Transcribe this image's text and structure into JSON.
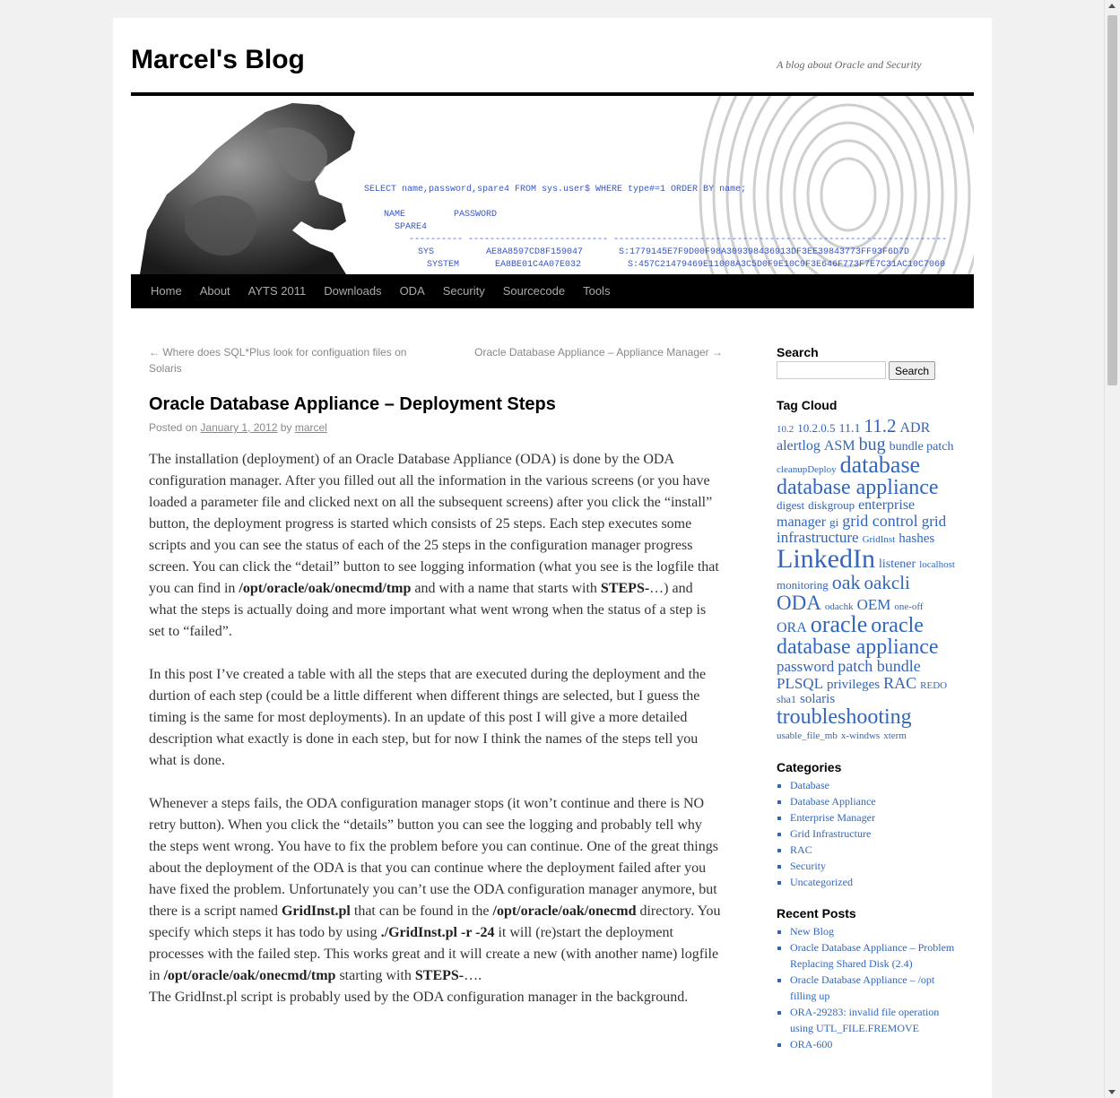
{
  "site": {
    "title": "Marcel's Blog",
    "description": "A blog about Oracle and Security"
  },
  "banner": {
    "sql_line": "SELECT name,password,spare4 FROM sys.user$ WHERE type#=1 ORDER BY name;",
    "col1": "NAME",
    "col2": "PASSWORD",
    "col3": "SPARE4",
    "dashes": "---------- -------------------------- --------------------------------------------------------------",
    "row1_name": "SYS",
    "row1_hash": "AE8A8597CD8F159047",
    "row1_spare": "S:1779145E7F9D00F98A309398436913DF3EE39843773FF93F6D7D",
    "row2_name": "SYSTEM",
    "row2_hash": "EA8BE01C4A07E032",
    "row2_spare": "S:457C21479469E11008A3C5D0F9E10C9F3E646F773F7E7C31AC10C7060"
  },
  "menu": [
    "Home",
    "About",
    "AYTS 2011",
    "Downloads",
    "ODA",
    "Security",
    "Sourcecode",
    "Tools"
  ],
  "post": {
    "nav_prev": "← Where does SQL*Plus look for configuation files on Solaris",
    "nav_next": "Oracle Database Appliance – Appliance Manager →",
    "title": "Oracle Database Appliance – Deployment Steps",
    "posted_on": "Posted on",
    "date": "January 1, 2012",
    "by": "by",
    "author": "marcel",
    "p1a": "The installation (deployment) of an Oracle Database Appliance (ODA) is done by the ODA configuration manager. After you filled out all the information in the various screens (or you have loaded a parameter file and clicked next on all the subsequent screens) after you click the “install” button, the deployment progress is started which consists of 25 steps. Each step executes some scripts and you can see the status of each of the 25 steps in the configuration manager progress screen. You can click the “detail” button to see logging information (what you see is the logfile that you can find in ",
    "p1b": "/opt/oracle/oak/onecmd/tmp",
    "p1c": " and with a name that starts with ",
    "p1d": "STEPS-",
    "p1e": "…) and what the steps is actually doing and more important what went wrong when the status of a step is set to “failed”.",
    "p2": "In this post I’ve created a table with all the steps that are executed during the deployment and the durtion of each step (could be a little different when different things are selected, but I guess the timing is the same for most deployments). In an update of this post I will give a more detailed description what exactly is done in each step, but for now I think the names of the steps tell you what is done.",
    "p3a": "Whenever a steps fails, the ODA configuration manager stops (it won’t continue and there is NO retry button). When you click the “details” button you can see the logging and probably tell why the steps went wrong. You have to fix the problem before you can continue. One of the great things about the deployment of the ODA is that you can continue where the deployment failed after you have fixed the problem. Unfortunately you can’t use the ODA configuration manager anymore, but there is a script named ",
    "p3b": "GridInst.pl",
    "p3c": " that can be found in the ",
    "p3d": "/opt/oracle/oak/onecmd",
    "p3e": " directory. You specify which steps it has todo by using ",
    "p3f": "./GridInst.pl -r -24",
    "p3g": " it will (re)start the deployment processes with the failed step. This works great and it will create a new (with another name) logfile in ",
    "p3h": "/opt/oracle/oak/onecmd/tmp",
    "p3i": " starting with ",
    "p3j": "STEPS-",
    "p3k": "….",
    "p3l": "The GridInst.pl script is probably used by the ODA configuration manager in the background."
  },
  "sidebar": {
    "search_title": "Search",
    "search_button": "Search",
    "search_value": "",
    "tagcloud_title": "Tag Cloud",
    "tags": [
      {
        "t": "10.2",
        "s": 11
      },
      {
        "t": "10.2.0.5",
        "s": 13
      },
      {
        "t": "11.1",
        "s": 14
      },
      {
        "t": "11.2",
        "s": 21
      },
      {
        "t": "ADR",
        "s": 16
      },
      {
        "t": "alertlog",
        "s": 16
      },
      {
        "t": "ASM",
        "s": 16
      },
      {
        "t": "bug",
        "s": 20
      },
      {
        "t": "bundle patch",
        "s": 14
      },
      {
        "t": "cleanupDeploy",
        "s": 11
      },
      {
        "t": "database",
        "s": 26
      },
      {
        "t": "database appliance",
        "s": 24
      },
      {
        "t": "digest",
        "s": 13
      },
      {
        "t": "diskgroup",
        "s": 13
      },
      {
        "t": "enterprise manager",
        "s": 16
      },
      {
        "t": "gi",
        "s": 13
      },
      {
        "t": "grid control",
        "s": 18
      },
      {
        "t": "grid infrastructure",
        "s": 17
      },
      {
        "t": "GridInst",
        "s": 11
      },
      {
        "t": "hashes",
        "s": 15
      },
      {
        "t": "LinkedIn",
        "s": 30
      },
      {
        "t": "listener",
        "s": 14
      },
      {
        "t": "localhost",
        "s": 11
      },
      {
        "t": "monitoring",
        "s": 13
      },
      {
        "t": "oak",
        "s": 22
      },
      {
        "t": "oakcli",
        "s": 21
      },
      {
        "t": "ODA",
        "s": 23
      },
      {
        "t": "odachk",
        "s": 11
      },
      {
        "t": "OEM",
        "s": 17
      },
      {
        "t": "one-off",
        "s": 11
      },
      {
        "t": "ORA",
        "s": 16
      },
      {
        "t": "oracle",
        "s": 26
      },
      {
        "t": "oracle database appliance",
        "s": 24
      },
      {
        "t": "password",
        "s": 17
      },
      {
        "t": "patch bundle",
        "s": 18
      },
      {
        "t": "PLSQL",
        "s": 17
      },
      {
        "t": "privileges",
        "s": 15
      },
      {
        "t": "RAC",
        "s": 18
      },
      {
        "t": "REDO",
        "s": 11
      },
      {
        "t": "sha1",
        "s": 12
      },
      {
        "t": "solaris",
        "s": 15
      },
      {
        "t": "troubleshooting",
        "s": 24
      },
      {
        "t": "usable_file_mb",
        "s": 11
      },
      {
        "t": "x-windws",
        "s": 11
      },
      {
        "t": "xterm",
        "s": 11
      }
    ],
    "categories_title": "Categories",
    "categories": [
      "Database",
      "Database Appliance",
      "Enterprise Manager",
      "Grid Infrastructure",
      "RAC",
      "Security",
      "Uncategorized"
    ],
    "recent_title": "Recent Posts",
    "recent": [
      "New Blog",
      "Oracle Database Appliance – Problem Replacing Shared Disk (2.4)",
      "Oracle Database Appliance – /opt filling up",
      "ORA-29283: invalid file operation using UTL_FILE.FREMOVE",
      "ORA-600"
    ]
  },
  "colors": {
    "link": "#3366bb",
    "menu_bg": "#000000",
    "page_bg": "#f1f1f1"
  }
}
